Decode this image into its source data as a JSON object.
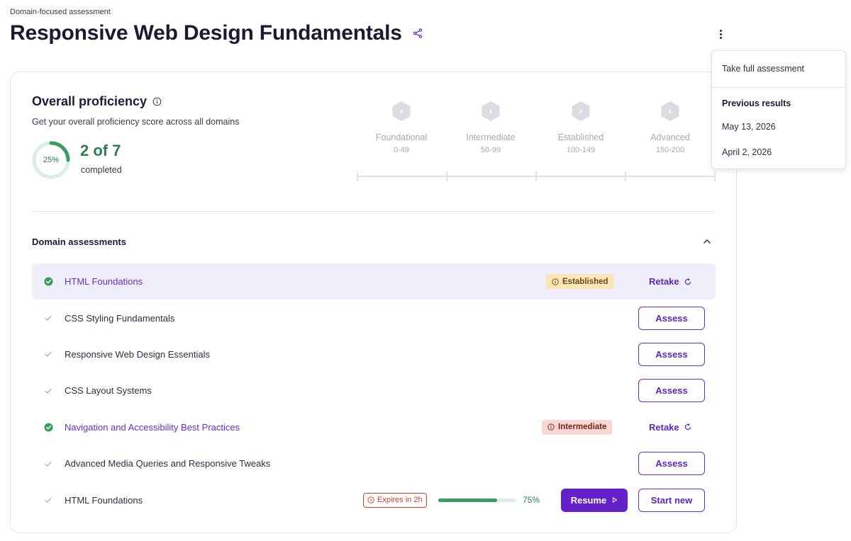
{
  "header": {
    "eyebrow": "Domain-focused assessment",
    "title": "Responsive Web Design Fundamentals"
  },
  "proficiency": {
    "title": "Overall proficiency",
    "subtitle": "Get your overall proficiency score across all domains",
    "progress_percent_label": "25%",
    "progress_fraction": 0.25,
    "completed_count": "2 of 7",
    "completed_label": "completed",
    "levels": [
      {
        "name": "Foundational",
        "range": "0-49"
      },
      {
        "name": "Intermediate",
        "range": "50-99"
      },
      {
        "name": "Established",
        "range": "100-149"
      },
      {
        "name": "Advanced",
        "range": "150-200"
      }
    ]
  },
  "domains": {
    "title": "Domain assessments",
    "rows": [
      {
        "name": "HTML Foundations",
        "done": true,
        "badge": "Established",
        "action": "Retake"
      },
      {
        "name": "CSS Styling Fundamentals",
        "done": false,
        "action": "Assess"
      },
      {
        "name": "Responsive Web Design Essentials",
        "done": false,
        "action": "Assess"
      },
      {
        "name": "CSS Layout Systems",
        "done": false,
        "action": "Assess"
      },
      {
        "name": "Navigation and Accessibility Best Practices",
        "done": true,
        "badge": "Intermediate",
        "action": "Retake"
      },
      {
        "name": "Advanced Media Queries and Responsive Tweaks",
        "done": false,
        "action": "Assess"
      },
      {
        "name": "HTML Foundations",
        "done": false,
        "expires": "Expires in 2h",
        "progress_fraction": 0.75,
        "progress_label": "75%",
        "resume_label": "Resume",
        "action": "Start new"
      }
    ]
  },
  "menu": {
    "take_full": "Take full assessment",
    "previous_title": "Previous results",
    "previous": [
      "May 13, 2026",
      "April 2, 2026"
    ]
  },
  "colors": {
    "accent": "#6421c9",
    "success": "#2e7d4f",
    "established_bg": "#fbe5b6",
    "intermediate_bg": "#f9d7d3",
    "danger": "#d63a2f"
  }
}
